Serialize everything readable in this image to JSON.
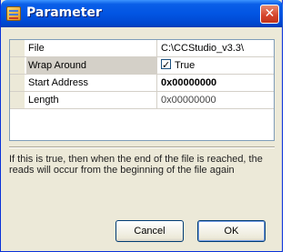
{
  "window": {
    "title": "Parameter",
    "close_glyph": "✕"
  },
  "grid": {
    "rows": [
      {
        "name": "File",
        "value": "C:\\CCStudio_v3.3\\"
      },
      {
        "name": "Wrap Around",
        "value": "True",
        "checked": true
      },
      {
        "name": "Start Address",
        "value": "0x00000000"
      },
      {
        "name": "Length",
        "value": "0x00000000"
      }
    ]
  },
  "description": "If this is true, then when the end of the file is reached, the reads will occur from the beginning of the file again",
  "buttons": {
    "cancel": "Cancel",
    "ok": "OK"
  },
  "icons": {
    "app": "parameter-window-icon",
    "close": "close-icon",
    "checkbox": "checkbox-checked-icon"
  }
}
